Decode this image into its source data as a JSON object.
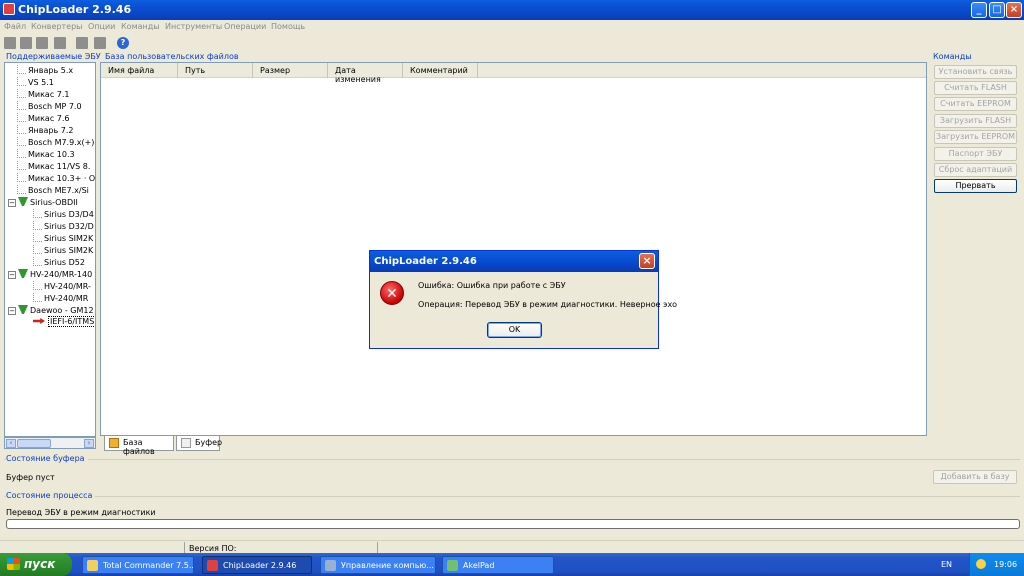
{
  "window": {
    "title": "ChipLoader 2.9.46"
  },
  "menu": [
    "Файл",
    "Конвертеры",
    "Опции",
    "Команды",
    "Инструменты",
    "Операции",
    "Помощь"
  ],
  "sections": {
    "ecu": "Поддерживаемые ЭБУ",
    "files": "База пользовательских файлов",
    "commands": "Команды",
    "buffer": "Состояние буфера",
    "process": "Состояние процесса"
  },
  "tree": [
    "Январь 5.x",
    "VS 5.1",
    "Микас 7.1",
    "Bosch MP 7.0",
    "Микас 7.6",
    "Январь 7.2",
    "Bosch M7.9.x(+)",
    "Микас 10.3",
    "Микас 11/VS 8.",
    "Микас 10.3+ · O",
    "Bosch ME7.x/Si",
    "Sirius-OBDII",
    "Sirius D3/D4",
    "Sirius D32/D",
    "Sirius SIM2K",
    "Sirius SIM2K",
    "Sirius D52",
    "HV-240/MR-140",
    "HV-240/MR-",
    "HV-240/MR",
    "Daewoo - GM12",
    "IEFI-6/ITMS"
  ],
  "table": {
    "columns": [
      "Имя файла",
      "Путь",
      "Размер",
      "Дата изменения",
      "Комментарий"
    ]
  },
  "tabs": [
    "База файлов",
    "Буфер"
  ],
  "commands": [
    "Установить связь",
    "Считать FLASH",
    "Считать EEPROM",
    "Загрузить FLASH",
    "Загрузить EEPROM",
    "Паспорт ЭБУ",
    "Сброс адаптаций",
    "Прервать"
  ],
  "buffer": {
    "status": "Буфер пуст",
    "add_button": "Добавить в базу"
  },
  "process": {
    "status": "Перевод ЭБУ в режим диагностики",
    "progress": 0
  },
  "statusbar": {
    "version_label": "Версия ПО:"
  },
  "dialog": {
    "title": "ChipLoader 2.9.46",
    "line1": "Ошибка: Ошибка при работе с ЭБУ",
    "line2": "Операция: Перевод ЭБУ в режим диагностики. Неверное эхо",
    "ok": "OK",
    "icon": "error-icon"
  },
  "taskbar": {
    "start": "пуск",
    "items": [
      "Total Commander 7.5...",
      "ChipLoader 2.9.46",
      "Управление компью...",
      "AkelPad"
    ],
    "lang": "EN",
    "clock": "19:06"
  }
}
